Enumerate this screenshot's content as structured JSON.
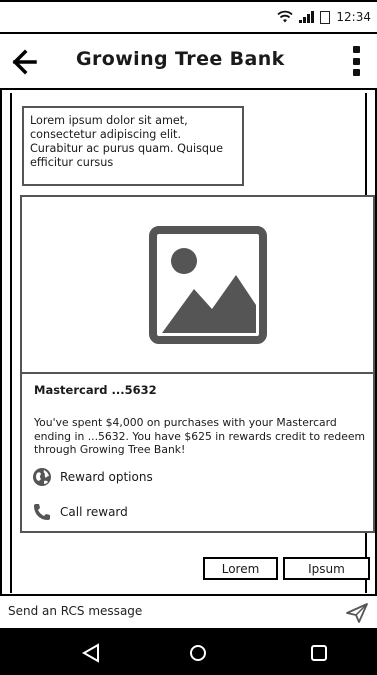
{
  "status_bar": {
    "time": "12:34",
    "icons": [
      "wifi-icon",
      "signal-icon",
      "battery-icon"
    ]
  },
  "app_bar": {
    "title": "Growing Tree Bank",
    "back_icon": "arrow-left-icon",
    "menu_icon": "more-vertical-icon"
  },
  "messages": {
    "bubble_text": "Lorem ipsum dolor sit amet, consectetur adipiscing elit. Curabitur ac purus quam. Quisque efficitur cursus"
  },
  "card": {
    "image_icon": "image-placeholder-icon",
    "title": "Mastercard ...5632",
    "description": "You've spent $4,000 on purchases with your Mastercard ending in ...5632. You have $625 in rewards credit to redeem through Growing Tree Bank!",
    "actions": [
      {
        "label": "Reward options",
        "icon": "globe-icon"
      },
      {
        "label": "Call reward",
        "icon": "phone-icon"
      }
    ]
  },
  "suggestions": [
    {
      "label": "Lorem"
    },
    {
      "label": "Ipsum"
    }
  ],
  "compose": {
    "placeholder": "Send an RCS message",
    "send_icon": "send-icon"
  },
  "nav_bar": {
    "icons": [
      "nav-back-icon",
      "nav-home-icon",
      "nav-recents-icon"
    ]
  },
  "colors": {
    "frame": "#000000",
    "border": "#555555",
    "nav_bg": "#000000"
  }
}
